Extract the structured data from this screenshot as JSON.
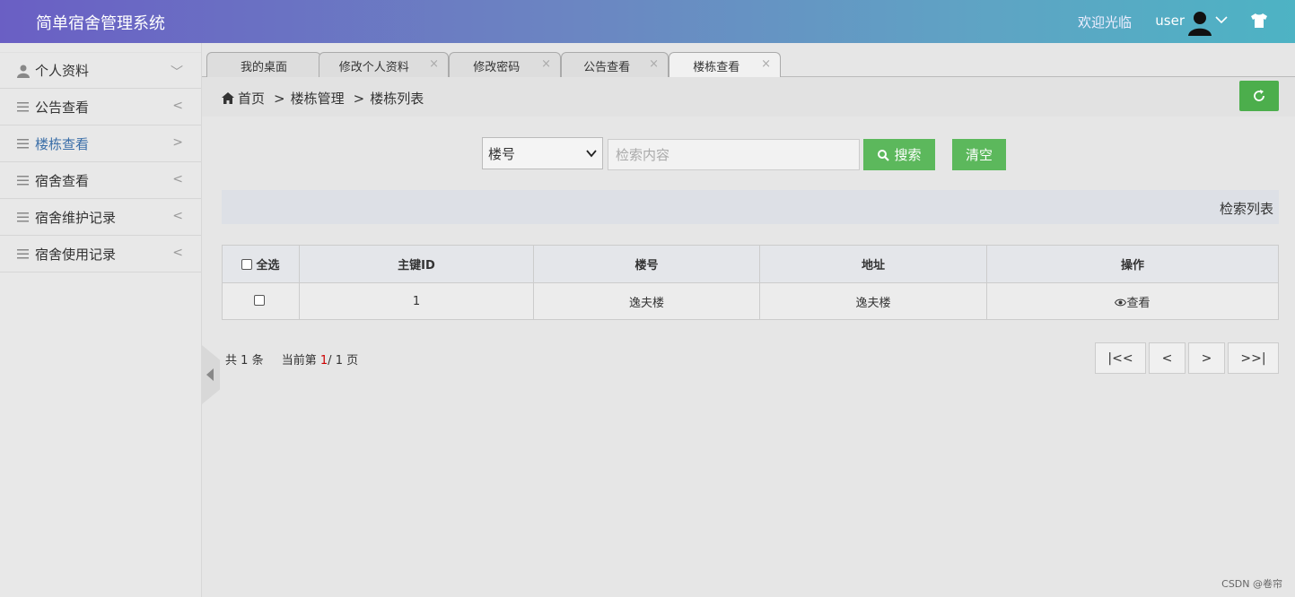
{
  "header": {
    "title": "简单宿舍管理系统",
    "welcome": "欢迎光临",
    "username": "user",
    "avatar_icon": "user-silhouette-icon",
    "theme_icon": "shirt-icon",
    "gradient": [
      "#6a5fc4",
      "#4db3c4"
    ]
  },
  "sidebar": {
    "items": [
      {
        "icon": "user-icon",
        "label": "个人资料",
        "arrow": "﹀"
      },
      {
        "icon": "menu-icon",
        "label": "公告查看",
        "arrow": "<"
      },
      {
        "icon": "menu-icon",
        "label": "楼栋查看",
        "arrow": ">"
      },
      {
        "icon": "menu-icon",
        "label": "宿舍查看",
        "arrow": "<"
      },
      {
        "icon": "menu-icon",
        "label": "宿舍维护记录",
        "arrow": "<"
      },
      {
        "icon": "menu-icon",
        "label": "宿舍使用记录",
        "arrow": "<"
      }
    ],
    "active_index": 2
  },
  "tabs": [
    {
      "label": "我的桌面"
    },
    {
      "label": "修改个人资料",
      "close": "×"
    },
    {
      "label": "修改密码",
      "close": "×"
    },
    {
      "label": "公告查看",
      "close": "×"
    },
    {
      "label": "楼栋查看",
      "close": "×",
      "active": true
    }
  ],
  "breadcrumb": {
    "home": "首页",
    "sep": ">",
    "level1": "楼栋管理",
    "level2": "楼栋列表"
  },
  "search": {
    "field_selected": "楼号",
    "placeholder": "检索内容",
    "search_label": "搜索",
    "clear_label": "清空"
  },
  "list_title": "检索列表",
  "table": {
    "select_all": "全选",
    "columns": [
      "主键ID",
      "楼号",
      "地址",
      "操作"
    ],
    "rows": [
      {
        "id": "1",
        "building": "逸夫楼",
        "address": "逸夫楼",
        "action": "查看"
      }
    ]
  },
  "pagination": {
    "total_prefix": "共",
    "total": "1",
    "total_suffix": "条",
    "current_prefix": "当前第",
    "current": "1",
    "slash": "/",
    "pages": "1",
    "pages_suffix": "页",
    "first": "|<<",
    "prev": "<",
    "next": ">",
    "last": ">>|"
  },
  "colors": {
    "accent_green": "#5cb85c",
    "active_menu": "#3a6ea8",
    "current_page": "#cc0000"
  },
  "watermark": "CSDN @卷帘"
}
